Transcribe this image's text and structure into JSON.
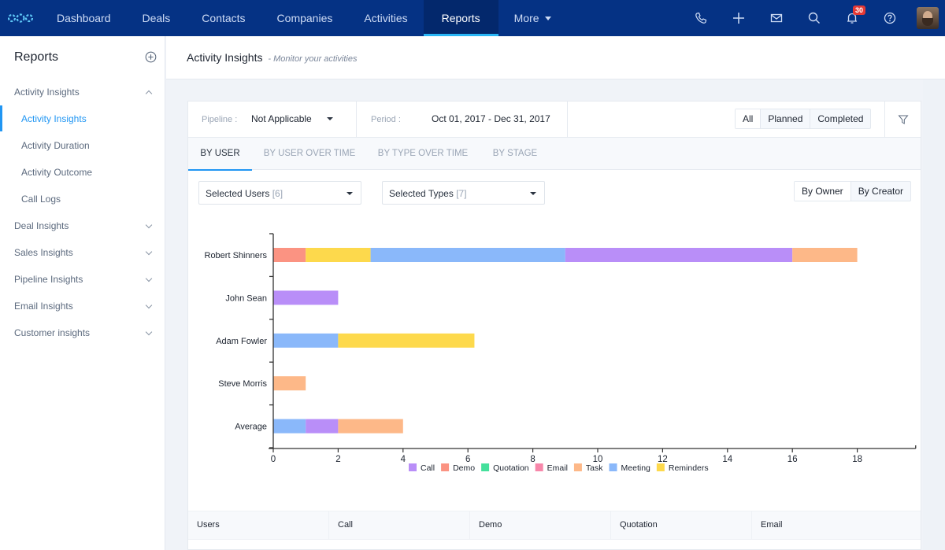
{
  "nav": {
    "items": [
      {
        "label": "Dashboard",
        "active": false
      },
      {
        "label": "Deals",
        "active": false
      },
      {
        "label": "Contacts",
        "active": false
      },
      {
        "label": "Companies",
        "active": false
      },
      {
        "label": "Activities",
        "active": false
      },
      {
        "label": "Reports",
        "active": true
      },
      {
        "label": "More",
        "active": false
      }
    ],
    "notification_count": "30",
    "icons": [
      "phone-icon",
      "plus-icon",
      "mail-icon",
      "search-icon",
      "bell-icon",
      "help-icon"
    ]
  },
  "sidebar": {
    "title": "Reports",
    "groups": [
      {
        "label": "Activity Insights",
        "expanded": true,
        "items": [
          {
            "label": "Activity Insights",
            "active": true
          },
          {
            "label": "Activity Duration",
            "active": false
          },
          {
            "label": "Activity Outcome",
            "active": false
          },
          {
            "label": "Call Logs",
            "active": false
          }
        ]
      },
      {
        "label": "Deal Insights",
        "expanded": false
      },
      {
        "label": "Sales Insights",
        "expanded": false
      },
      {
        "label": "Pipeline Insights",
        "expanded": false
      },
      {
        "label": "Email Insights",
        "expanded": false
      },
      {
        "label": "Customer insights",
        "expanded": false
      }
    ]
  },
  "header": {
    "title": "Activity Insights",
    "subtitle": "- Monitor your activities"
  },
  "filters": {
    "pipeline_label": "Pipeline :",
    "pipeline_value": "Not Applicable",
    "period_label": "Period :",
    "period_value": "Oct 01, 2017 - Dec 31, 2017",
    "status_options": [
      "All",
      "Planned",
      "Completed"
    ],
    "status_selected": "All"
  },
  "tabs": [
    {
      "label": "BY USER",
      "active": true
    },
    {
      "label": "BY USER OVER TIME",
      "active": false
    },
    {
      "label": "BY TYPE OVER TIME",
      "active": false
    },
    {
      "label": "BY STAGE",
      "active": false
    }
  ],
  "selectors": {
    "users_label": "Selected Users",
    "users_count": "[6]",
    "types_label": "Selected Types",
    "types_count": "[7]",
    "ownership_options": [
      "By Owner",
      "By Creator"
    ]
  },
  "chart_data": {
    "type": "bar",
    "orientation": "horizontal",
    "stacked": true,
    "title": "",
    "xlabel": "",
    "ylabel": "",
    "xlim": [
      0,
      19.8
    ],
    "xticks": [
      0,
      2,
      4,
      6,
      8,
      10,
      12,
      14,
      16,
      18
    ],
    "grid": false,
    "legend_position": "bottom",
    "categories": [
      "Robert Shinners",
      "John Sean",
      "Adam Fowler",
      "Steve Morris",
      "Average"
    ],
    "stack_order": [
      "Demo",
      "Reminders",
      "Meeting",
      "Call",
      "Task",
      "Quotation",
      "Email"
    ],
    "series": [
      {
        "name": "Call",
        "color": "#b98ef8",
        "values": [
          7,
          2,
          0,
          0,
          1
        ]
      },
      {
        "name": "Demo",
        "color": "#fb9382",
        "values": [
          1,
          0,
          0,
          0,
          0
        ]
      },
      {
        "name": "Quotation",
        "color": "#45e09c",
        "values": [
          0,
          0,
          0,
          0,
          0
        ]
      },
      {
        "name": "Email",
        "color": "#f787aa",
        "values": [
          0,
          0,
          0,
          0,
          0
        ]
      },
      {
        "name": "Task",
        "color": "#fdb888",
        "values": [
          2,
          0,
          0,
          1,
          2
        ]
      },
      {
        "name": "Meeting",
        "color": "#8ab8fa",
        "values": [
          6,
          0,
          2,
          0,
          1
        ]
      },
      {
        "name": "Reminders",
        "color": "#fdd94c",
        "values": [
          2,
          0,
          4.2,
          0,
          0
        ]
      }
    ],
    "per_bar_order": [
      [
        "Demo",
        "Reminders",
        "Meeting",
        "Call",
        "Task"
      ],
      [
        "Call"
      ],
      [
        "Meeting",
        "Reminders"
      ],
      [
        "Task"
      ],
      [
        "Meeting",
        "Call",
        "Task"
      ]
    ]
  },
  "table": {
    "columns": [
      "Users",
      "Call",
      "Demo",
      "Quotation",
      "Email"
    ]
  }
}
